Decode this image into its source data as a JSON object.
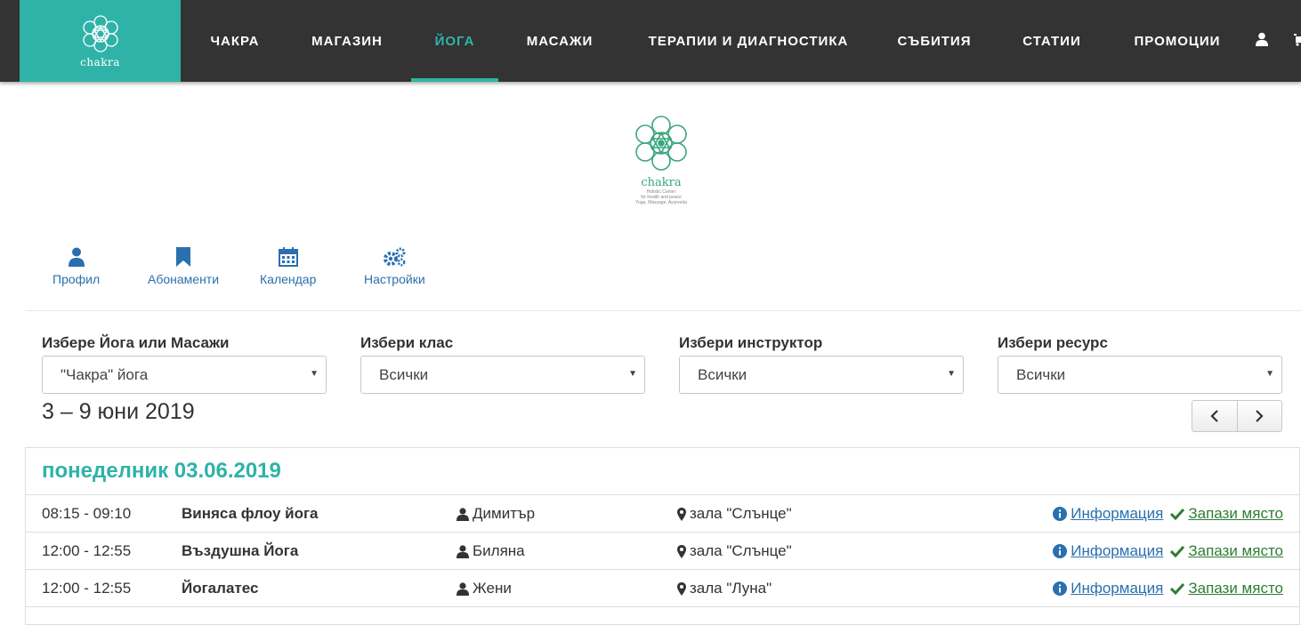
{
  "nav": {
    "brand_text": "chakra",
    "items": [
      {
        "label": "ЧАКРА",
        "active": false
      },
      {
        "label": "МАГАЗИН",
        "active": false
      },
      {
        "label": "ЙОГА",
        "active": true
      },
      {
        "label": "МАСАЖИ",
        "active": false
      },
      {
        "label": "ТЕРАПИИ И ДИАГНОСТИКА",
        "active": false
      },
      {
        "label": "СЪБИТИЯ",
        "active": false
      },
      {
        "label": "СТАТИИ",
        "active": false
      },
      {
        "label": "ПРОМОЦИИ",
        "active": false
      }
    ],
    "icons": [
      "user-icon",
      "cart-icon"
    ]
  },
  "logo": {
    "word": "chakra",
    "tagline": [
      "Holistic Center",
      "for health and peace",
      "Yoga, Massage, Ayurveda"
    ]
  },
  "toolbar": {
    "items": [
      {
        "label": "Профил",
        "icon": "user-icon"
      },
      {
        "label": "Абонаменти",
        "icon": "bookmark-icon"
      },
      {
        "label": "Календар",
        "icon": "calendar-icon"
      },
      {
        "label": "Настройки",
        "icon": "cogs-icon"
      }
    ]
  },
  "filters": [
    {
      "label": "Избере Йога или Масажи",
      "value": "\"Чакра\" йога"
    },
    {
      "label": "Избери клас",
      "value": "Всички"
    },
    {
      "label": "Избери инструктор",
      "value": "Всички"
    },
    {
      "label": "Избери ресурс",
      "value": "Всички"
    }
  ],
  "week_range": "3 – 9 юни 2019",
  "schedule": {
    "day": "понеделник 03.06.2019",
    "info_label": "Информация",
    "book_label": "Запази място",
    "rows": [
      {
        "time": "08:15 - 09:10",
        "class": "Виняса флоу йога",
        "instructor": "Димитър",
        "room": "зала \"Слънце\""
      },
      {
        "time": "12:00 - 12:55",
        "class": "Въздушна Йога",
        "instructor": "Биляна",
        "room": "зала \"Слънце\""
      },
      {
        "time": "12:00 - 12:55",
        "class": "Йогалатес",
        "instructor": "Жени",
        "room": "зала \"Луна\""
      }
    ]
  },
  "colors": {
    "accent": "#2fb3a8",
    "nav_bg": "#333333",
    "link": "#2a6faf",
    "book": "#2e7d32"
  }
}
